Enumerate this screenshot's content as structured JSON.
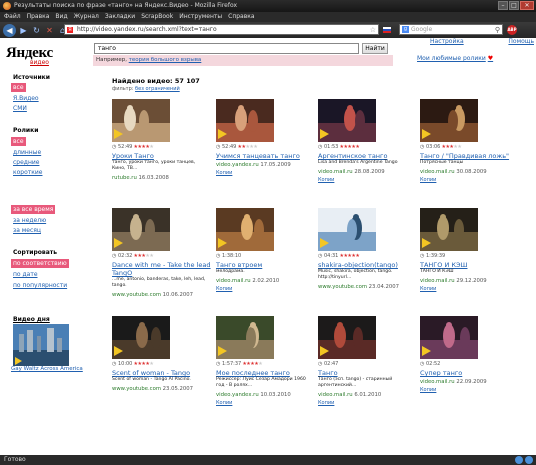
{
  "window": {
    "title": "Результаты поиска по фразе «танго» на Яндекс.Видео - Mozilla Firefox",
    "menu": [
      "Файл",
      "Правка",
      "Вид",
      "Журнал",
      "Закладки",
      "ScrapBook",
      "Инструменты",
      "Справка"
    ],
    "url": "http://video.yandex.ru/search.xml?text=танго",
    "search_engine": "Google",
    "status": "Готово"
  },
  "page": {
    "logo": "Яндекс",
    "logo_sub": "видео",
    "query": "танго",
    "search_button": "Найти",
    "tip_prefix": "Например,",
    "tip_link": "теория большого взрыва",
    "settings_link": "Настройка",
    "help_link": "Помощь",
    "favorites_link": "Мои любимые ролики",
    "found": "Найдено видео: 57 107",
    "filter_label": "фильтр:",
    "filter_value": "без ограничений"
  },
  "sidebar": {
    "sources_title": "Источники",
    "sources": [
      "все",
      "Я.Видео",
      "СМИ"
    ],
    "clips_title": "Ролики",
    "clips": [
      "все",
      "длинные",
      "средние",
      "короткие"
    ],
    "time": [
      "за все время",
      "за неделю",
      "за месяц"
    ],
    "sort_title": "Сортировать",
    "sort": [
      "по соответствию",
      "по дате",
      "по популярности"
    ],
    "vod_title": "Видео дня",
    "vod_link": "Gay Waltz Across America"
  },
  "results": [
    {
      "duration": "52:49",
      "stars": 4,
      "title": "Уроки Танго",
      "desc": "танго, уроки танго, уроки танцев, Кино, ТВ...",
      "source": "rutube.ru",
      "date": "16.03.2008",
      "copy": ""
    },
    {
      "duration": "52:49",
      "stars": 2,
      "title": "Учимся танцевать танго",
      "desc": "",
      "source": "video.yandex.ru",
      "date": "17.05.2009",
      "copy": "Копии"
    },
    {
      "duration": "01:53",
      "stars": 5,
      "title": "Аргентинское танго",
      "desc": "Lisa and Brenda's Argentine Tango",
      "source": "video.mail.ru",
      "date": "28.08.2009",
      "copy": "Копии"
    },
    {
      "duration": "03:06",
      "stars": 3,
      "title": "Танго / \"Правдивая ложь\"",
      "desc": "Потрясные танцы",
      "source": "video.mail.ru",
      "date": "30.08.2009",
      "copy": "Копии"
    },
    {
      "duration": "02:32",
      "stars": 3,
      "title": "Dance with me - Take the lead",
      "title2": "TangO",
      "desc": "...me, antonio, banderas, take, leh, lead, tango.",
      "source": "www.youtube.com",
      "date": "10.06.2007",
      "copy": ""
    },
    {
      "duration": "1:38:10",
      "stars": 0,
      "title": "Танго втроем",
      "desc": "мелодрама.",
      "source": "video.mail.ru",
      "date": "2.02.2010",
      "copy": "Копии"
    },
    {
      "duration": "04:31",
      "stars": 5,
      "title": "shakira-objection(tango)",
      "desc": "Music, shakira, objection, tango. http://tinyurl...",
      "source": "www.youtube.com",
      "date": "23.04.2007",
      "copy": ""
    },
    {
      "duration": "1:39:39",
      "stars": 0,
      "title": "ТАНГО И КЭШ",
      "desc": "ТАНГО И КЭШ",
      "source": "video.mail.ru",
      "date": "29.12.2009",
      "copy": "Копии"
    },
    {
      "duration": "10:00",
      "stars": 4,
      "title": "Scent of woman - Tango",
      "desc": "Scent of woman - Tango Al Pacino.",
      "source": "www.youtube.com",
      "date": "23.05.2007",
      "copy": ""
    },
    {
      "duration": "1:57:37",
      "stars": 4,
      "title": "Мое последнее танго",
      "desc": "Режиссер: Луис Сезар Амадори 1960 год - В ролях...",
      "source": "video.yandex.ru",
      "date": "10.03.2010",
      "copy": "Копии"
    },
    {
      "duration": "02:47",
      "stars": 0,
      "title": "Танго",
      "desc": "Танго (эсп. tango) - старинный аргентинский...",
      "source": "video.mail.ru",
      "date": "6.01.2010",
      "copy": "Копии"
    },
    {
      "duration": "02:52",
      "stars": 0,
      "title": "Супер танго",
      "desc": "",
      "source": "video.mail.ru",
      "date": "22.09.2009",
      "copy": "Копии"
    }
  ],
  "colors": {
    "accent": "#e8597b",
    "link": "#2060b0",
    "source": "#2a7a2a",
    "pink_band": "#f4d7dd"
  }
}
